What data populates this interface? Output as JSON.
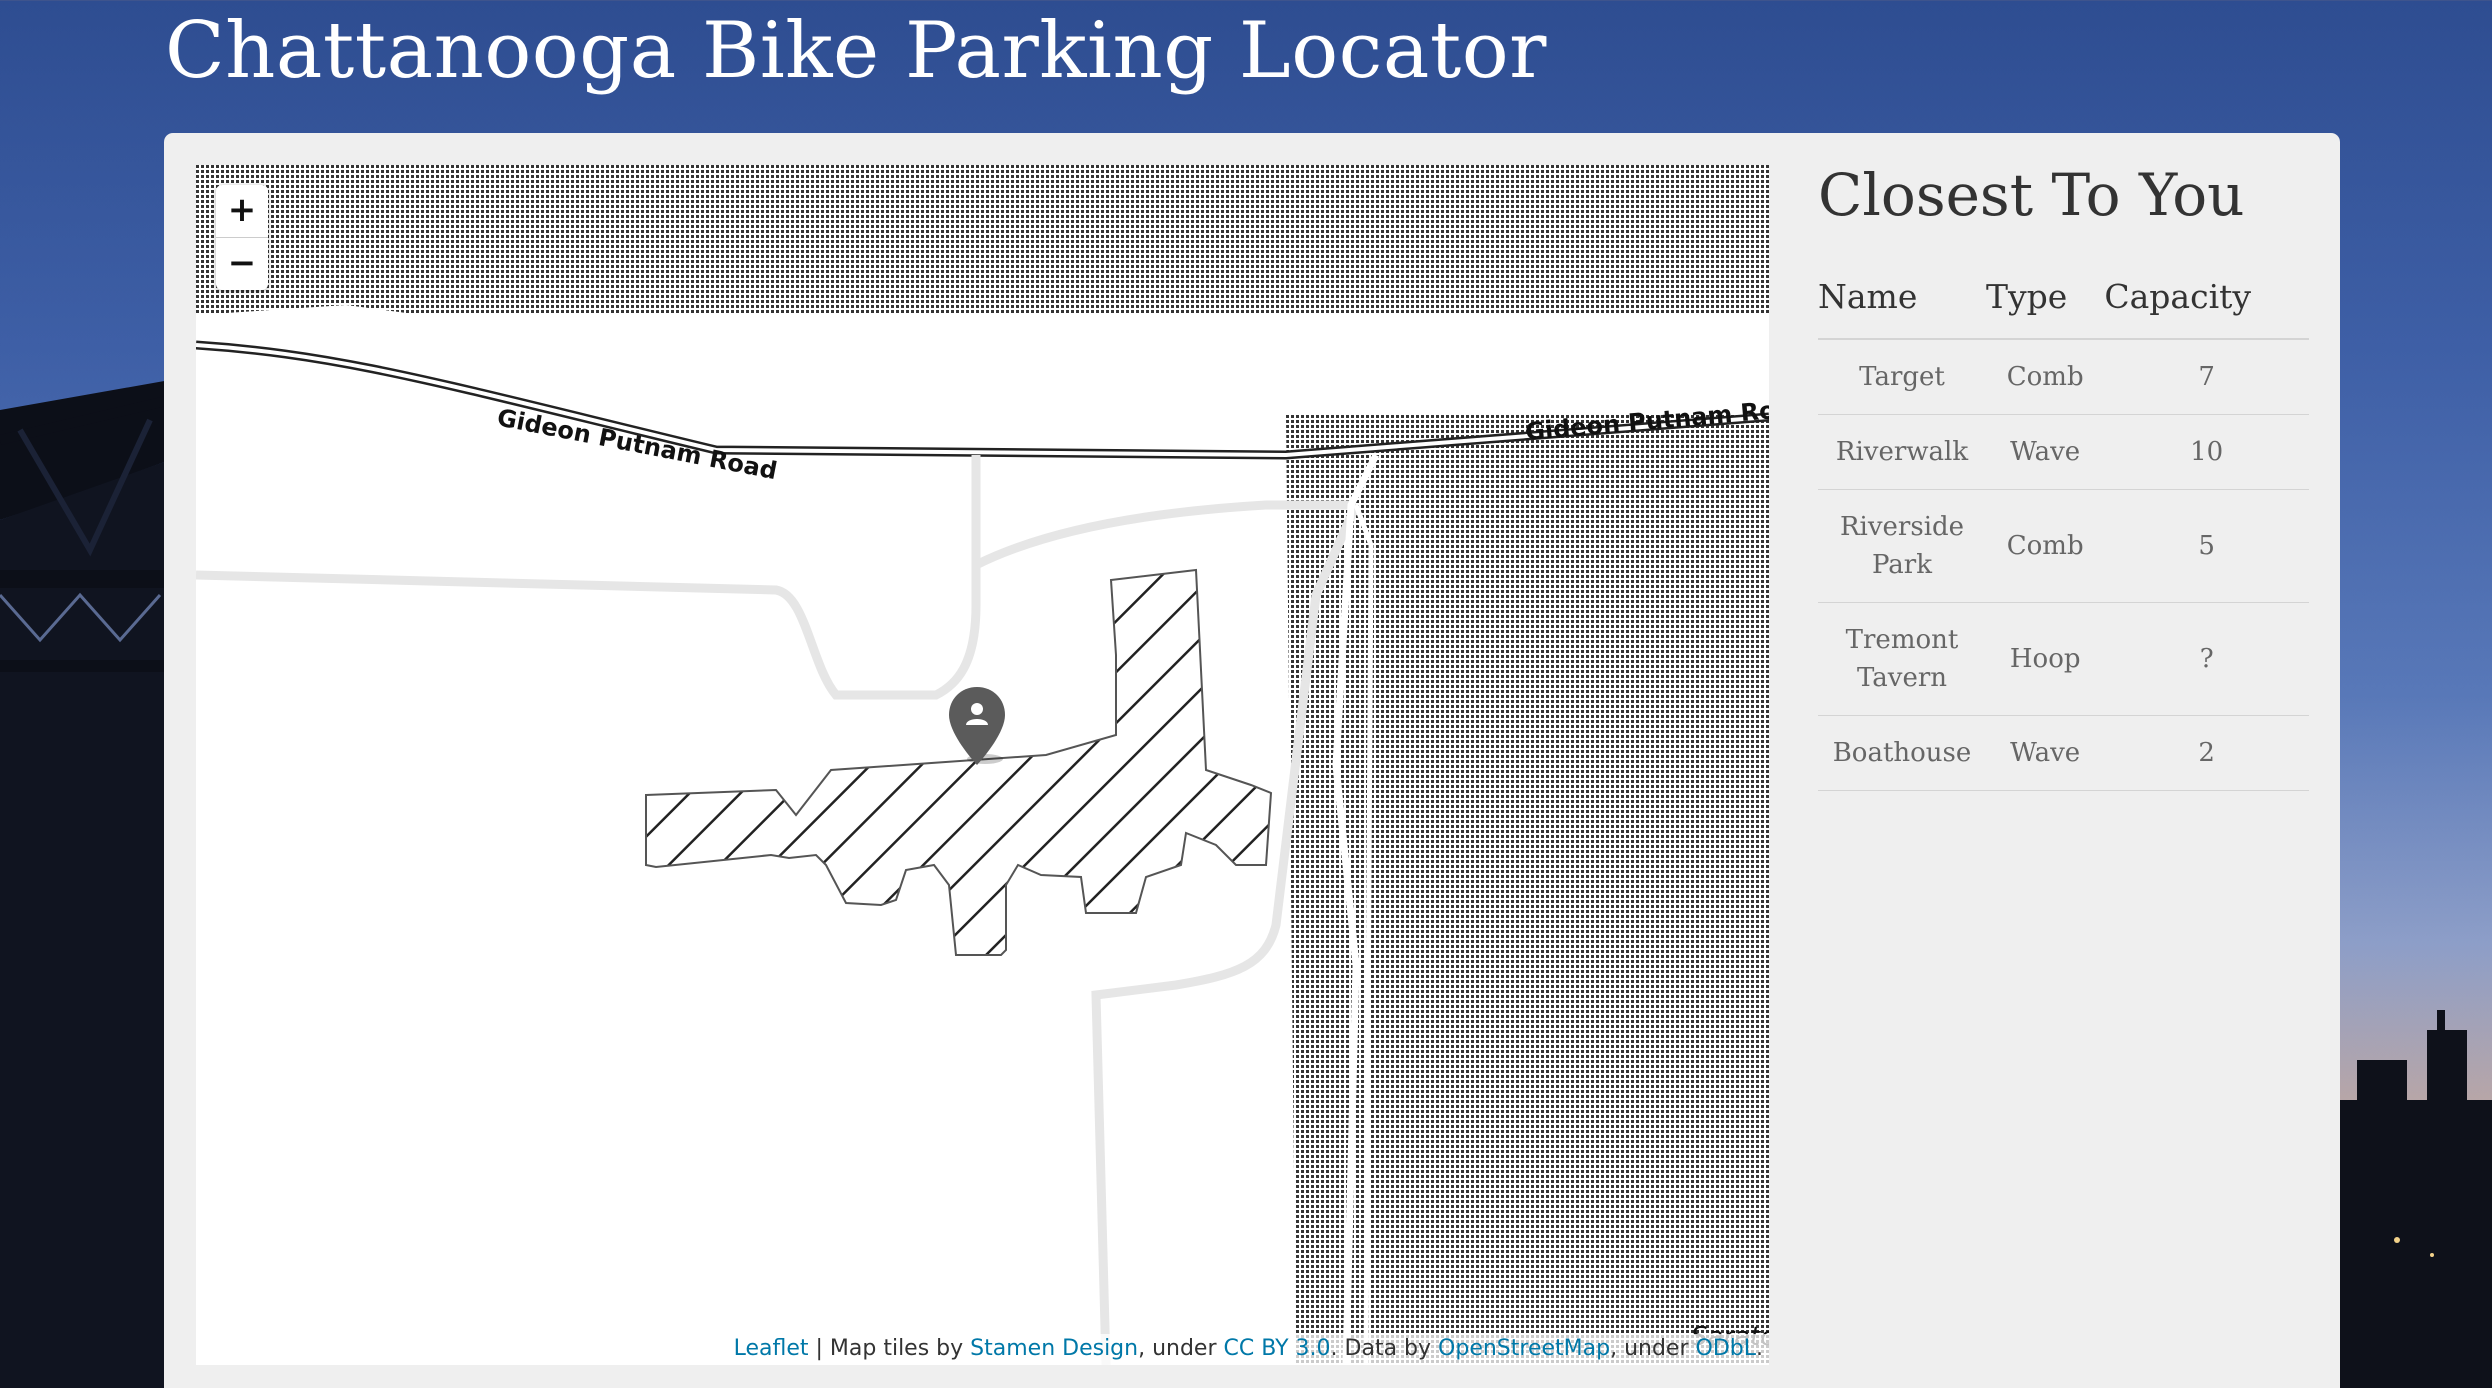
{
  "header": {
    "title": "Chattanooga Bike Parking Locator"
  },
  "map": {
    "zoom_in_label": "+",
    "zoom_out_label": "−",
    "road_labels": [
      "Gideon Putnam Road",
      "Gideon Putnam Road"
    ],
    "edge_label": "Sarato",
    "marker_icon": "user-location-pin-icon",
    "attribution": {
      "leaflet": "Leaflet",
      "sep": " | ",
      "tiles_prefix": "Map tiles by ",
      "stamen": "Stamen Design",
      "under1": ", under ",
      "cc": "CC BY 3.0",
      "data_by": ". Data by ",
      "osm": "OpenStreetMap",
      "under2": ", under ",
      "odbl": "ODbL",
      "end": "."
    }
  },
  "sidebar": {
    "title": "Closest To You",
    "columns": [
      "Name",
      "Type",
      "Capacity"
    ],
    "rows": [
      {
        "name": "Target",
        "type": "Comb",
        "capacity": "7"
      },
      {
        "name": "Riverwalk",
        "type": "Wave",
        "capacity": "10"
      },
      {
        "name": "Riverside Park",
        "type": "Comb",
        "capacity": "5"
      },
      {
        "name": "Tremont Tavern",
        "type": "Hoop",
        "capacity": "?"
      },
      {
        "name": "Boathouse",
        "type": "Wave",
        "capacity": "2"
      }
    ]
  },
  "colors": {
    "sky_top": "#2e4d91",
    "panel": "#efefef",
    "link": "#0078a8"
  }
}
